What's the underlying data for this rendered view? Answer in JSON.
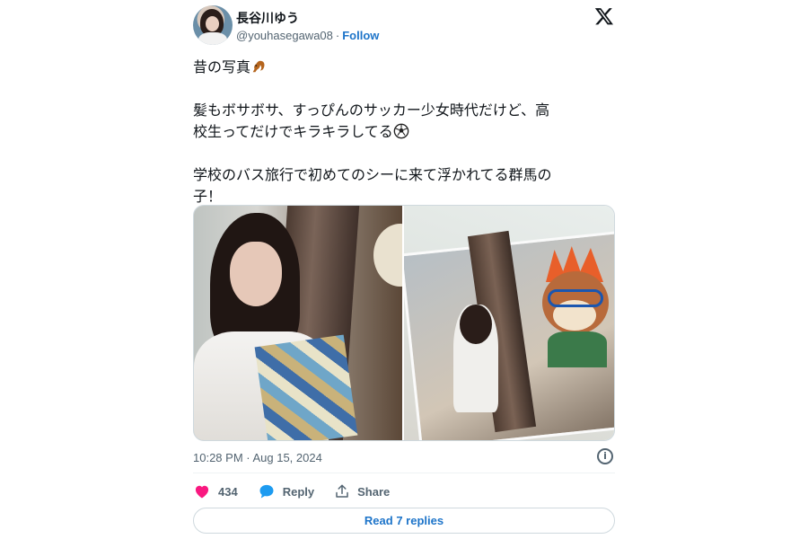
{
  "author": {
    "display_name": "長谷川ゆう",
    "handle": "@youhasegawa08",
    "separator": "·",
    "follow_label": "Follow"
  },
  "tweet": {
    "line1": "昔の写真",
    "line2a": "髪もボサボサ、すっぴんのサッカー少女時代だけど、高",
    "line2b": "校生ってだけでキラキラしてる",
    "line3a": "学校のバス旅行で初めてのシーに来て浮かれてる群馬の",
    "line3b": "子！"
  },
  "media": {
    "photos": [
      "photo-1",
      "photo-2"
    ]
  },
  "timestamp": "10:28 PM · Aug 15, 2024",
  "actions": {
    "like_count": "434",
    "reply_label": "Reply",
    "share_label": "Share"
  },
  "read_replies_label": "Read 7 replies",
  "colors": {
    "link_blue": "#1d74c9",
    "like_pink": "#f91880",
    "reply_blue": "#1d9bf0",
    "muted": "#536471"
  },
  "icons": [
    "x-logo-icon",
    "squirrel-emoji-icon",
    "soccer-ball-emoji-icon",
    "info-icon",
    "heart-icon",
    "reply-bubble-icon",
    "share-icon"
  ]
}
